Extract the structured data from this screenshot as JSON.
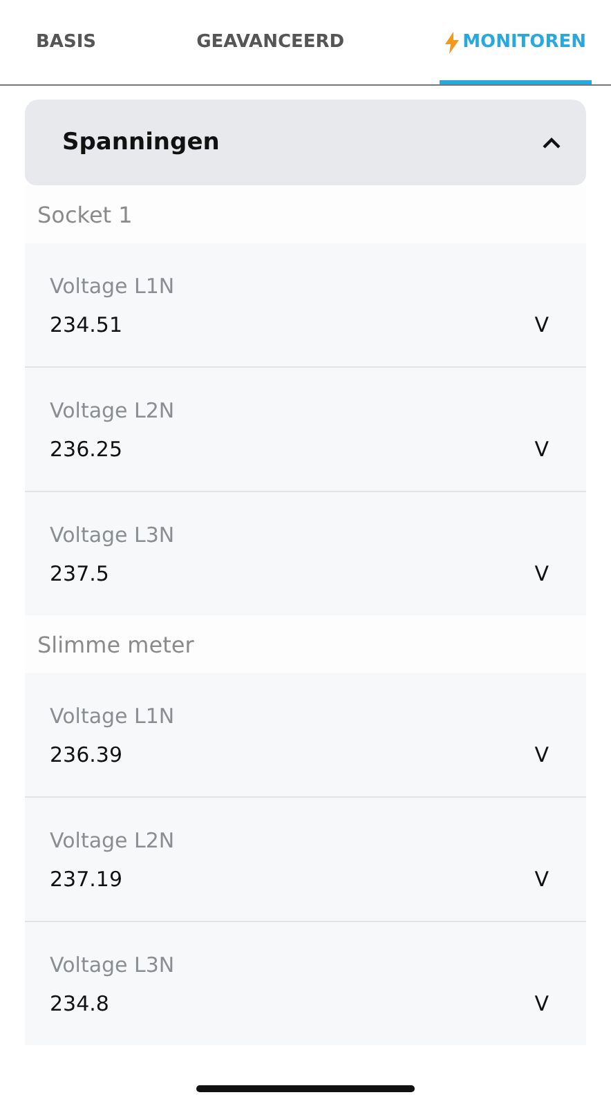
{
  "tabs": [
    {
      "label": "BASIS",
      "selected": false,
      "icon": false
    },
    {
      "label": "GEAVANCEERD",
      "selected": false,
      "icon": false
    },
    {
      "label": "MONITOREN",
      "selected": true,
      "icon": true
    }
  ],
  "section": {
    "title": "Spanningen",
    "expanded": true,
    "groups": [
      {
        "label": "Socket 1",
        "rows": [
          {
            "label": "Voltage L1N",
            "value": "234.51",
            "unit": "V"
          },
          {
            "label": "Voltage L2N",
            "value": "236.25",
            "unit": "V"
          },
          {
            "label": "Voltage L3N",
            "value": "237.5",
            "unit": "V"
          }
        ]
      },
      {
        "label": "Slimme meter",
        "rows": [
          {
            "label": "Voltage L1N",
            "value": "236.39",
            "unit": "V"
          },
          {
            "label": "Voltage L2N",
            "value": "237.19",
            "unit": "V"
          },
          {
            "label": "Voltage L3N",
            "value": "234.8",
            "unit": "V"
          }
        ]
      }
    ]
  }
}
